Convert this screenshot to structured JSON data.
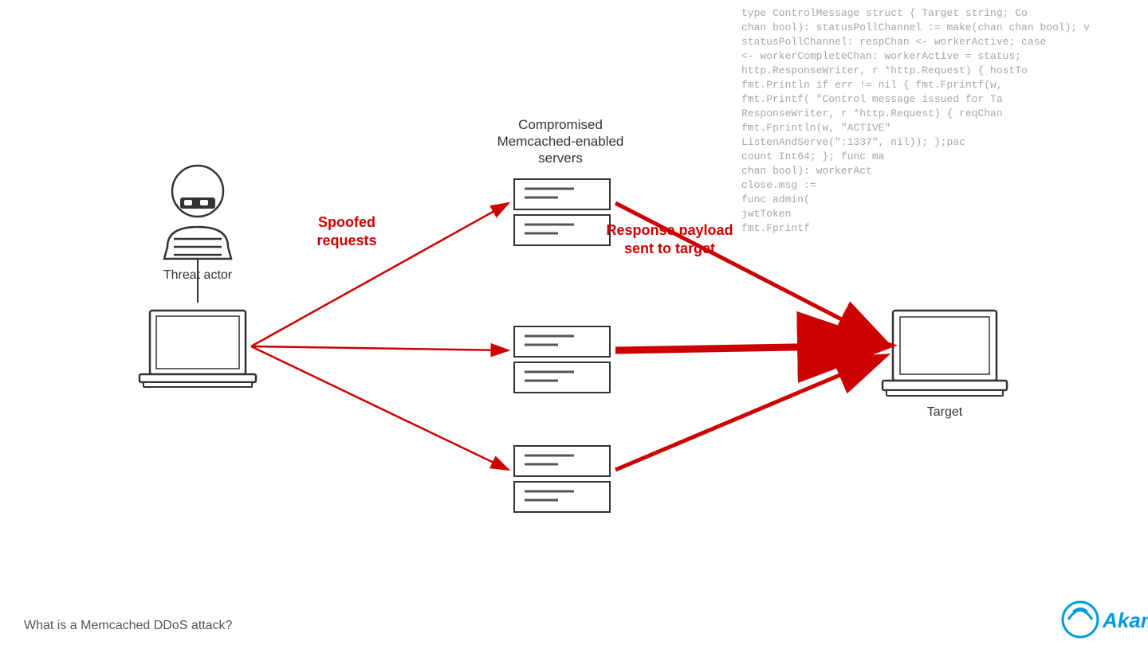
{
  "code_lines": [
    "type ControlMessage struct { Target string; Co",
    "chan bool): statusPollChannel := make(chan chan bool); v",
    "statusPollChannel: respChan <- workerActive; case",
    "<- workerCompleteChan: workerActive = status;",
    "http.ResponseWriter, r *http.Request) { hostTo",
    "fmt.Println(w, if err != nil { fmt.Fprintf(w,",
    "fmt.Printf(  \"Control message issued for Ta",
    "ResponseWriter, r *http.Request) { reqChan",
    "fmt.Fprintln(w, \"ACTIVE\"",
    "ListenAndServe(\":1337\", nil)); };pac",
    "count Int64; }; func ma",
    "chan bool): workerAct",
    "close.msg :=",
    "func admin(",
    "jwtToken",
    "fmt.Fprintf"
  ],
  "diagram": {
    "threat_actor_label": "Threat actor",
    "servers_title_line1": "Compromised",
    "servers_title_line2": "Memcached-enabled",
    "servers_title_line3": "servers",
    "spoofed_label_line1": "Spoofed",
    "spoofed_label_line2": "requests",
    "response_label_line1": "Response payload",
    "response_label_line2": "sent to target",
    "target_label": "Target"
  },
  "footer": {
    "bottom_text": "What is a Memcached DDoS attack?",
    "logo_text": "Akamai"
  },
  "colors": {
    "red": "#cc0000",
    "dark": "#333333",
    "blue": "#009bde"
  }
}
